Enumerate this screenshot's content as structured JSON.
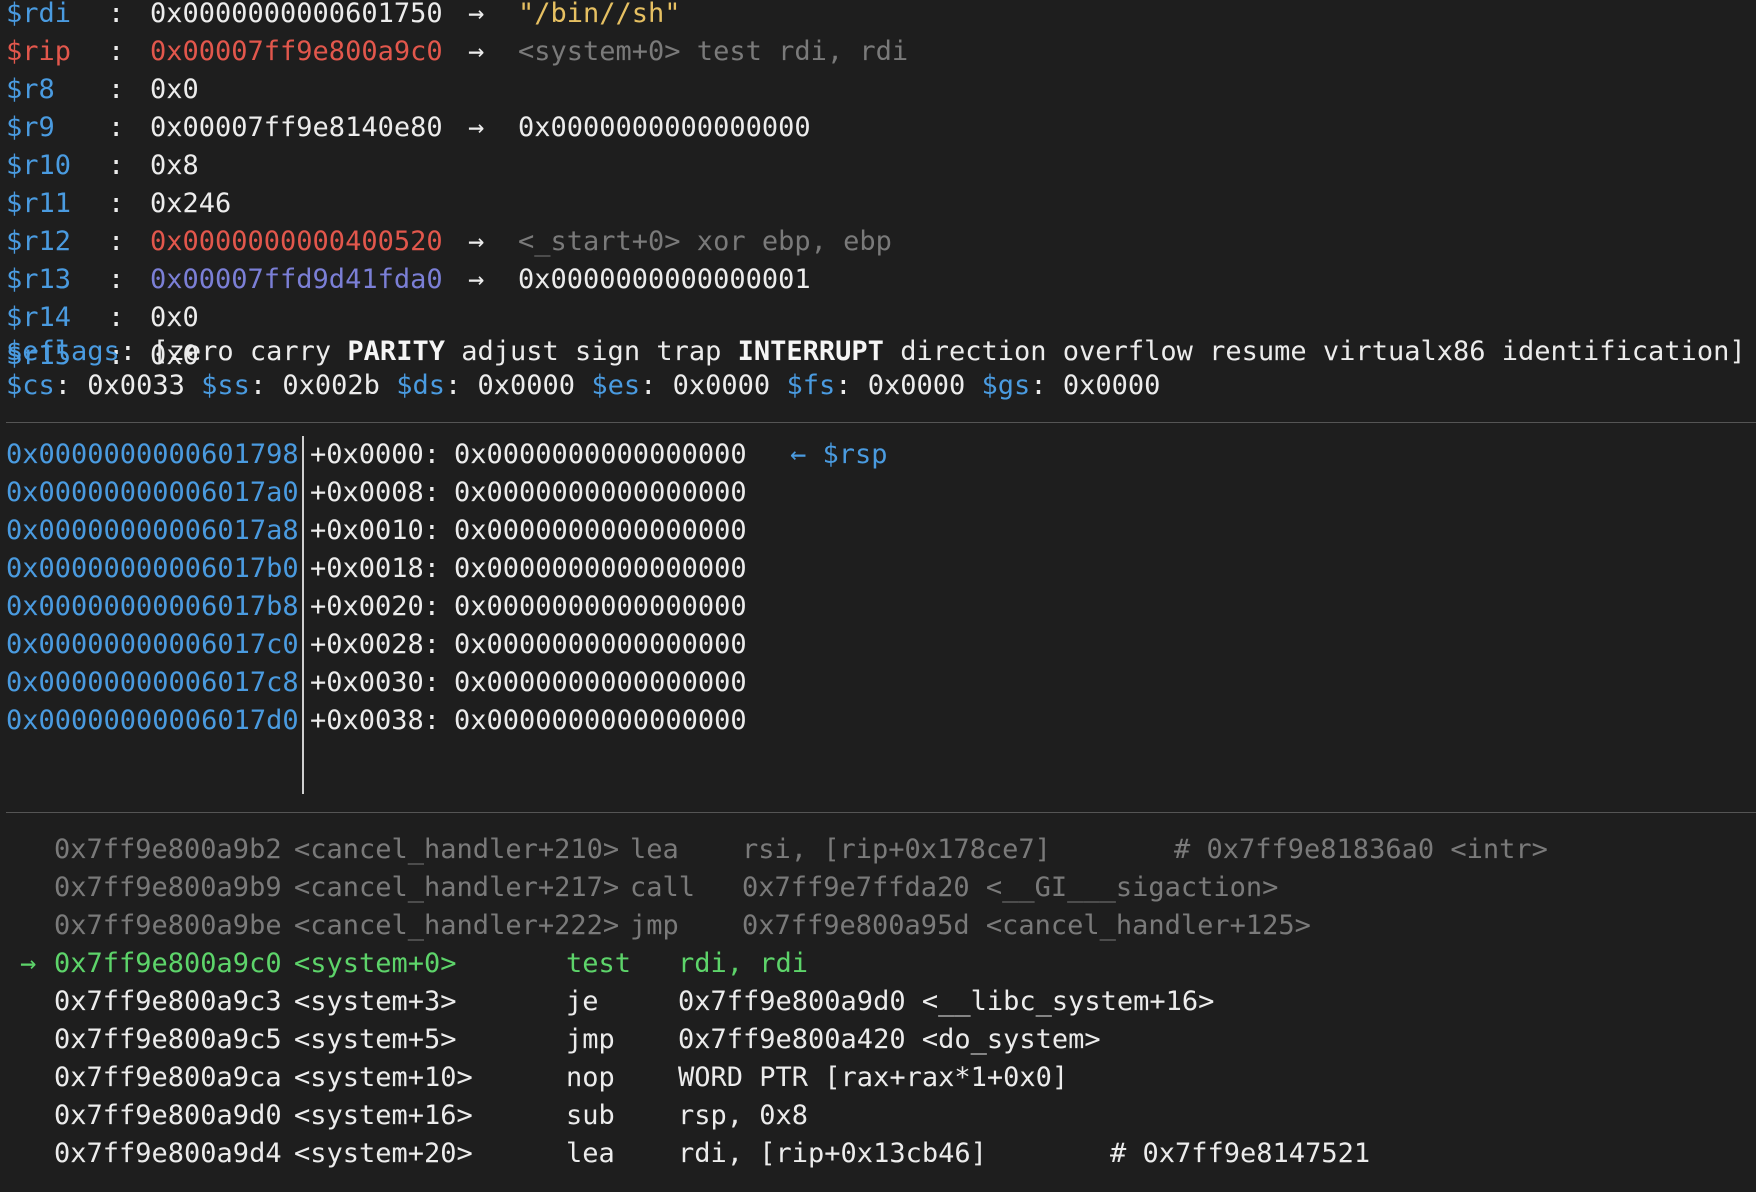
{
  "registers": [
    {
      "name": "$rdi",
      "value": "0x0000000000601750",
      "arrow": "→",
      "target": "\"/bin//sh\"",
      "value_color": "white",
      "target_color": "yellow",
      "highlight": false
    },
    {
      "name": "$rip",
      "value": "0x00007ff9e800a9c0",
      "arrow": "→",
      "target": "<system+0> test rdi, rdi",
      "value_color": "red",
      "target_color": "dim",
      "highlight": true
    },
    {
      "name": "$r8",
      "value": "0x0",
      "arrow": "",
      "target": "",
      "value_color": "white",
      "target_color": "white",
      "highlight": false
    },
    {
      "name": "$r9",
      "value": "0x00007ff9e8140e80",
      "arrow": "→",
      "target": "0x0000000000000000",
      "value_color": "white",
      "target_color": "white",
      "highlight": false
    },
    {
      "name": "$r10",
      "value": "0x8",
      "arrow": "",
      "target": "",
      "value_color": "white",
      "target_color": "white",
      "highlight": false
    },
    {
      "name": "$r11",
      "value": "0x246",
      "arrow": "",
      "target": "",
      "value_color": "white",
      "target_color": "white",
      "highlight": false
    },
    {
      "name": "$r12",
      "value": "0x0000000000400520",
      "arrow": "→",
      "target": "<_start+0> xor ebp, ebp",
      "value_color": "red",
      "target_color": "dim",
      "highlight": false
    },
    {
      "name": "$r13",
      "value": "0x00007ffd9d41fda0",
      "arrow": "→",
      "target": "0x0000000000000001",
      "value_color": "purple",
      "target_color": "white",
      "highlight": false
    },
    {
      "name": "$r14",
      "value": "0x0",
      "arrow": "",
      "target": "",
      "value_color": "white",
      "target_color": "white",
      "highlight": false
    },
    {
      "name": "$r15",
      "value": "0x0",
      "arrow": "",
      "target": "",
      "value_color": "white",
      "target_color": "white",
      "highlight": false
    }
  ],
  "eflags": {
    "label": "$eflags",
    "flags": [
      {
        "name": "zero",
        "set": false
      },
      {
        "name": "carry",
        "set": false
      },
      {
        "name": "PARITY",
        "set": true
      },
      {
        "name": "adjust",
        "set": false
      },
      {
        "name": "sign",
        "set": false
      },
      {
        "name": "trap",
        "set": false
      },
      {
        "name": "INTERRUPT",
        "set": true
      },
      {
        "name": "direction",
        "set": false
      },
      {
        "name": "overflow",
        "set": false
      },
      {
        "name": "resume",
        "set": false
      },
      {
        "name": "virtualx86",
        "set": false
      },
      {
        "name": "identification",
        "set": false
      }
    ]
  },
  "segments": [
    {
      "name": "$cs",
      "value": "0x0033"
    },
    {
      "name": "$ss",
      "value": "0x002b"
    },
    {
      "name": "$ds",
      "value": "0x0000"
    },
    {
      "name": "$es",
      "value": "0x0000"
    },
    {
      "name": "$fs",
      "value": "0x0000"
    },
    {
      "name": "$gs",
      "value": "0x0000"
    }
  ],
  "stack": [
    {
      "addr": "0x0000000000601798",
      "offset": "+0x0000:",
      "value": "0x0000000000000000",
      "tag": "← $rsp"
    },
    {
      "addr": "0x00000000006017a0",
      "offset": "+0x0008:",
      "value": "0x0000000000000000",
      "tag": ""
    },
    {
      "addr": "0x00000000006017a8",
      "offset": "+0x0010:",
      "value": "0x0000000000000000",
      "tag": ""
    },
    {
      "addr": "0x00000000006017b0",
      "offset": "+0x0018:",
      "value": "0x0000000000000000",
      "tag": ""
    },
    {
      "addr": "0x00000000006017b8",
      "offset": "+0x0020:",
      "value": "0x0000000000000000",
      "tag": ""
    },
    {
      "addr": "0x00000000006017c0",
      "offset": "+0x0028:",
      "value": "0x0000000000000000",
      "tag": ""
    },
    {
      "addr": "0x00000000006017c8",
      "offset": "+0x0030:",
      "value": "0x0000000000000000",
      "tag": ""
    },
    {
      "addr": "0x00000000006017d0",
      "offset": "+0x0038:",
      "value": "0x0000000000000000",
      "tag": ""
    }
  ],
  "disasm": [
    {
      "marker": "",
      "addr": "0x7ff9e800a9b2",
      "sym": "<cancel_handler+210>",
      "mnem": "lea",
      "ops": "rsi, [rip+0x178ce7]",
      "comment": "# 0x7ff9e81836a0 <intr>",
      "state": "past"
    },
    {
      "marker": "",
      "addr": "0x7ff9e800a9b9",
      "sym": "<cancel_handler+217>",
      "mnem": "call",
      "ops": "0x7ff9e7ffda20 <__GI___sigaction>",
      "comment": "",
      "state": "past"
    },
    {
      "marker": "",
      "addr": "0x7ff9e800a9be",
      "sym": "<cancel_handler+222>",
      "mnem": "jmp",
      "ops": "0x7ff9e800a95d <cancel_handler+125>",
      "comment": "",
      "state": "past"
    },
    {
      "marker": "→",
      "addr": "0x7ff9e800a9c0",
      "sym": "<system+0>",
      "mnem": "test",
      "ops": "rdi, rdi",
      "comment": "",
      "state": "current"
    },
    {
      "marker": "",
      "addr": "0x7ff9e800a9c3",
      "sym": "<system+3>",
      "mnem": "je",
      "ops": "0x7ff9e800a9d0 <__libc_system+16>",
      "comment": "",
      "state": "next"
    },
    {
      "marker": "",
      "addr": "0x7ff9e800a9c5",
      "sym": "<system+5>",
      "mnem": "jmp",
      "ops": "0x7ff9e800a420 <do_system>",
      "comment": "",
      "state": "next"
    },
    {
      "marker": "",
      "addr": "0x7ff9e800a9ca",
      "sym": "<system+10>",
      "mnem": "nop",
      "ops": "WORD PTR [rax+rax*1+0x0]",
      "comment": "",
      "state": "next"
    },
    {
      "marker": "",
      "addr": "0x7ff9e800a9d0",
      "sym": "<system+16>",
      "mnem": "sub",
      "ops": "rsp, 0x8",
      "comment": "",
      "state": "next"
    },
    {
      "marker": "",
      "addr": "0x7ff9e800a9d4",
      "sym": "<system+20>",
      "mnem": "lea",
      "ops": "rdi, [rip+0x13cb46]",
      "comment": "# 0x7ff9e8147521",
      "state": "next"
    }
  ],
  "colors": {
    "background": "#1e1e1e",
    "register_blue": "#4a9be0",
    "highlight_red": "#e2574c",
    "pointer_purple": "#7b7fd6",
    "string_yellow": "#e6c062",
    "current_green": "#5dd46a",
    "dim_gray": "#7a7a7a"
  }
}
